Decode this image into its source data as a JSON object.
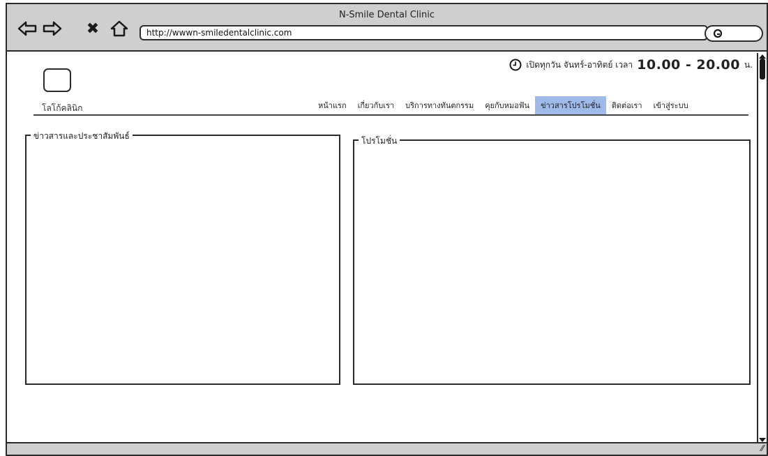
{
  "window": {
    "title": "N-Smile Dental Clinic",
    "url": "http://wwwn-smiledentalclinic.com"
  },
  "toolbar": {
    "back_icon": "back-arrow-icon",
    "forward_icon": "forward-arrow-icon",
    "stop_icon": "close-x-icon",
    "home_icon": "home-icon",
    "stop_glyph": "✖",
    "search_icon": "search-icon"
  },
  "header": {
    "hours_prefix": "เปิดทุกวัน จันทร์-อาทิตย์  เวลา",
    "hours_time": "10.00 - 20.00",
    "hours_suffix": "น.",
    "logo_label": "โลโก้คลินิก"
  },
  "nav": {
    "items": [
      {
        "label": "หน้าแรก"
      },
      {
        "label": "เกี่ยวกับเรา"
      },
      {
        "label": "บริการทางทันตกรรม"
      },
      {
        "label": "คุยกับหมอฟัน"
      },
      {
        "label": "ข่าวสารโปรโมชั่น"
      },
      {
        "label": "ติดต่อเรา"
      },
      {
        "label": "เข้าสู่ระบบ"
      }
    ],
    "active_index": 4,
    "active_color": "#9fb9e8"
  },
  "panels": {
    "news": {
      "legend": "ข่าวสารและประชาสัมพันธ์"
    },
    "promo": {
      "legend": "โปรโมชั่น"
    }
  },
  "statusbar": {
    "grip": "⁄⁄"
  }
}
